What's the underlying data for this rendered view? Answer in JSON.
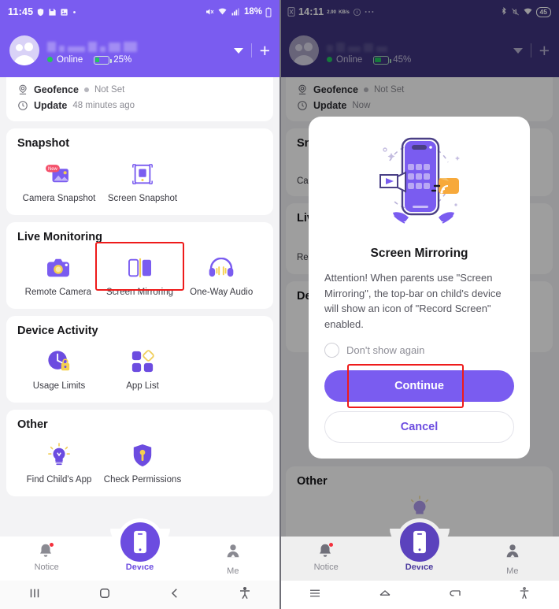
{
  "left": {
    "statusbar": {
      "time": "11:45",
      "icons": [
        "shield-icon",
        "save-icon",
        "image-icon",
        "dot-icon"
      ],
      "right_icons": [
        "mute-icon",
        "wifi-icon",
        "signal-icon"
      ],
      "battery": "18%"
    },
    "header": {
      "status": "Online",
      "battery": "25%",
      "caret": "chevron-down-icon",
      "add": "+"
    },
    "status_card": {
      "rows": [
        {
          "icon": "geofence-icon",
          "key": "Geofence",
          "value": "Not Set"
        },
        {
          "icon": "clock-icon",
          "key": "Update",
          "value": "48 minutes ago"
        }
      ]
    },
    "sections": [
      {
        "title": "Snapshot",
        "tiles": [
          {
            "label": "Camera Snapshot",
            "icon": "camera-snapshot-icon",
            "badge": "New"
          },
          {
            "label": "Screen Snapshot",
            "icon": "screen-snapshot-icon"
          }
        ]
      },
      {
        "title": "Live Monitoring",
        "tiles": [
          {
            "label": "Remote Camera",
            "icon": "remote-camera-icon"
          },
          {
            "label": "Screen Mirroring",
            "icon": "screen-mirroring-icon",
            "highlighted": true
          },
          {
            "label": "One-Way Audio",
            "icon": "headphones-icon"
          }
        ]
      },
      {
        "title": "Device Activity",
        "tiles": [
          {
            "label": "Usage Limits",
            "icon": "usage-limits-icon"
          },
          {
            "label": "App List",
            "icon": "app-list-icon"
          }
        ]
      },
      {
        "title": "Other",
        "tiles": [
          {
            "label": "Find Child's App",
            "icon": "lightbulb-icon"
          },
          {
            "label": "Check Permissions",
            "icon": "shield-key-icon"
          }
        ]
      }
    ],
    "bottom_nav": [
      {
        "label": "Notice",
        "icon": "bell-icon",
        "active": false,
        "badge": true
      },
      {
        "label": "Device",
        "icon": "phone-icon",
        "active": true
      },
      {
        "label": "Me",
        "icon": "person-icon",
        "active": false
      }
    ],
    "system_nav": [
      "recents-icon",
      "home-icon",
      "back-icon",
      "accessibility-icon"
    ]
  },
  "right": {
    "statusbar": {
      "time": "14:11",
      "netspeed_value": "2.90",
      "netspeed_unit": "KB/s",
      "icons": [
        "sim-icon",
        "info-icon",
        "more-icon"
      ],
      "right_icons": [
        "bluetooth-icon",
        "mute-icon",
        "wifi-icon"
      ],
      "battery": "45"
    },
    "header": {
      "status": "Online",
      "battery": "45%",
      "caret": "chevron-down-icon",
      "add": "+"
    },
    "status_card": {
      "rows": [
        {
          "icon": "geofence-icon",
          "key": "Geofence",
          "value": "Not Set"
        },
        {
          "icon": "clock-icon",
          "key": "Update",
          "value": "Now"
        }
      ]
    },
    "behind": {
      "snapshot_title": "Snapshot",
      "camera_label": "Ca",
      "live_title": "Live Monitoring",
      "remote_label": "Re",
      "device_title": "Device Activity",
      "other_title": "Other"
    },
    "dialog": {
      "illustration": "screen-mirroring-illustration",
      "title": "Screen Mirroring",
      "body": "Attention! When parents use \"Screen Mirroring\", the top-bar on child's device will show an icon of \"Record Screen\" enabled.",
      "checkbox_label": "Don't show again",
      "checkbox_checked": false,
      "primary_button": "Continue",
      "secondary_button": "Cancel",
      "primary_highlighted": true
    },
    "bottom_nav": [
      {
        "label": "Notice",
        "icon": "bell-icon",
        "active": false,
        "badge": true
      },
      {
        "label": "Device",
        "icon": "phone-icon",
        "active": true
      },
      {
        "label": "Me",
        "icon": "person-icon",
        "active": false
      }
    ],
    "system_nav": [
      "menu-icon",
      "home-icon",
      "back-icon",
      "accessibility-icon"
    ]
  },
  "colors": {
    "brand_purple": "#7a5cf0",
    "brand_purple_dark": "#6c4ce0",
    "dim_purple": "#3f3580",
    "highlight_red": "#ee1b1b",
    "online_green": "#22c55e",
    "accent_yellow": "#f5d04e",
    "accent_orange": "#f7a93b"
  }
}
